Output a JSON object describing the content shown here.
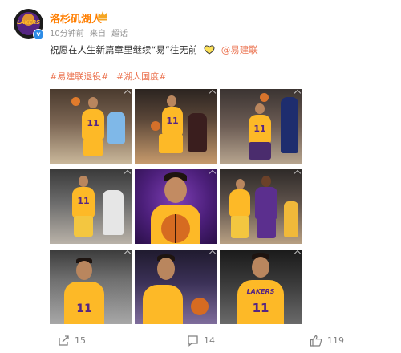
{
  "author": {
    "name": "洛杉矶湖人",
    "avatar_text": "LAKERS",
    "time": "10分钟前",
    "source_prefix": "来自",
    "source": "超话"
  },
  "post": {
    "text": "祝愿在人生新篇章里继续“易”往无前",
    "mention": "@易建联"
  },
  "hashtags": [
    "#易建联退役#",
    "#湖人国度#"
  ],
  "images": [
    {
      "icon": "player-dribbling-photo"
    },
    {
      "icon": "player-driving-photo"
    },
    {
      "icon": "player-shooting-photo"
    },
    {
      "icon": "player-defending-photo"
    },
    {
      "icon": "portrait-with-basketball-photo"
    },
    {
      "icon": "player-guarding-photo"
    },
    {
      "icon": "player-number-11-photo"
    },
    {
      "icon": "player-closeup-photo"
    },
    {
      "icon": "player-jersey-11-photo"
    }
  ],
  "footer": {
    "reposts": "15",
    "comments": "14",
    "likes": "119"
  },
  "colors": {
    "username": "#ff7e00",
    "link": "#eb7350",
    "lakers_gold": "#fdb927",
    "lakers_purple": "#552583",
    "verified": "#2d8ce6"
  }
}
